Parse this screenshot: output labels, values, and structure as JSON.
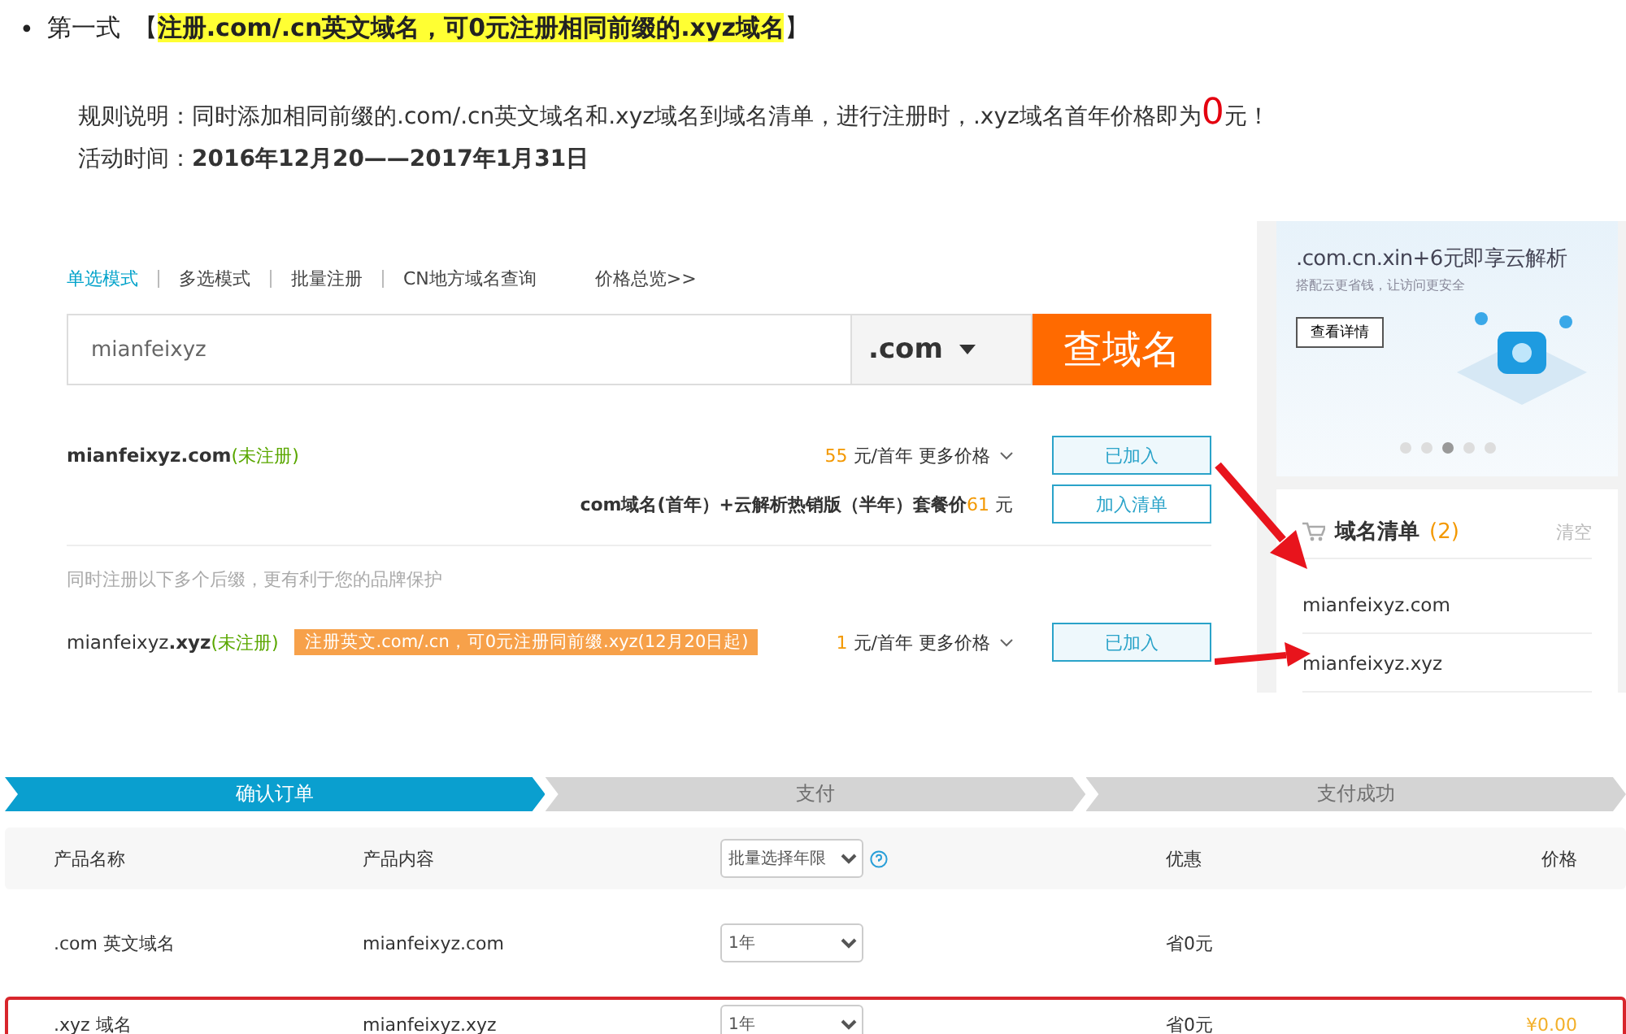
{
  "heading": {
    "bullet": "•",
    "label": "第一式",
    "open": "【",
    "text": "注册.com/.cn英文域名，可0元注册相同前缀的.xyz域名",
    "close": "】"
  },
  "rule": {
    "before": "规则说明：同时添加相同前缀的.com/.cn英文域名和.xyz域名到域名清单，进行注册时，.xyz域名首年价格即为",
    "highlight": "0",
    "after": "元！"
  },
  "period": "活动时间：**2016年12月20——2017年1月31日**",
  "search_page": {
    "modes": [
      {
        "label": "单选模式",
        "selected": true
      },
      {
        "label": "多选模式",
        "selected": false
      },
      {
        "label": "批量注册",
        "selected": false
      },
      {
        "label": "CN地方域名查询",
        "selected": false
      }
    ],
    "price_link": "价格总览>>",
    "search": {
      "value": "mianfeixyz",
      "suffix": ".com",
      "button": "查域名"
    },
    "results": [
      {
        "kind": "domain",
        "domain": "**mianfeixyz.com**",
        "status": "(未注册)",
        "price": "55",
        "unit": "元/首年",
        "more": "更多价格",
        "button": "已加入",
        "added": true
      },
      {
        "kind": "bundle",
        "text": "com域名(首年）+云解析热销版（半年）套餐价",
        "price": "61",
        "unit": "元",
        "button": "加入清单",
        "added": false
      },
      {
        "kind": "hint",
        "text": "同时注册以下多个后缀，更有利于您的品牌保护"
      },
      {
        "kind": "domain",
        "domain": "mianfeixyz**.xyz**",
        "status": "(未注册)",
        "promo": "注册英文.com/.cn，可0元注册同前缀.xyz(12月20日起)",
        "price": "1",
        "unit": "元/首年",
        "more": "更多价格",
        "button": "已加入",
        "added": true
      }
    ],
    "ad": {
      "title": ".com.cn.xin+6元即享云解析",
      "subtitle": "搭配云更省钱，让访问更安全",
      "button": "查看详情",
      "dots": [
        {
          "selected": false
        },
        {
          "selected": false
        },
        {
          "selected": true
        },
        {
          "selected": false
        },
        {
          "selected": false
        }
      ]
    },
    "cart": {
      "title": "域名清单",
      "count": "(2)",
      "clear": "清空",
      "items": [
        "mianfeixyz.com",
        "mianfeixyz.xyz"
      ]
    }
  },
  "order": {
    "steps": [
      {
        "label": "确认订单",
        "selected": true
      },
      {
        "label": "支付",
        "selected": false
      },
      {
        "label": "支付成功",
        "selected": false
      }
    ],
    "columns": {
      "name": "产品名称",
      "content": "产品内容",
      "term_select": "批量选择年限",
      "discount": "优惠",
      "price": "价格"
    },
    "rows": [
      {
        "name": ".com 英文域名",
        "content": "mianfeixyz.com",
        "term": "1年",
        "discount": "省0元",
        "highlighted": false
      },
      {
        "name": ".xyz 域名",
        "content": "mianfeixyz.xyz",
        "term": "1年",
        "discount": "省0元",
        "price": "¥0.00",
        "highlighted": true
      }
    ]
  }
}
